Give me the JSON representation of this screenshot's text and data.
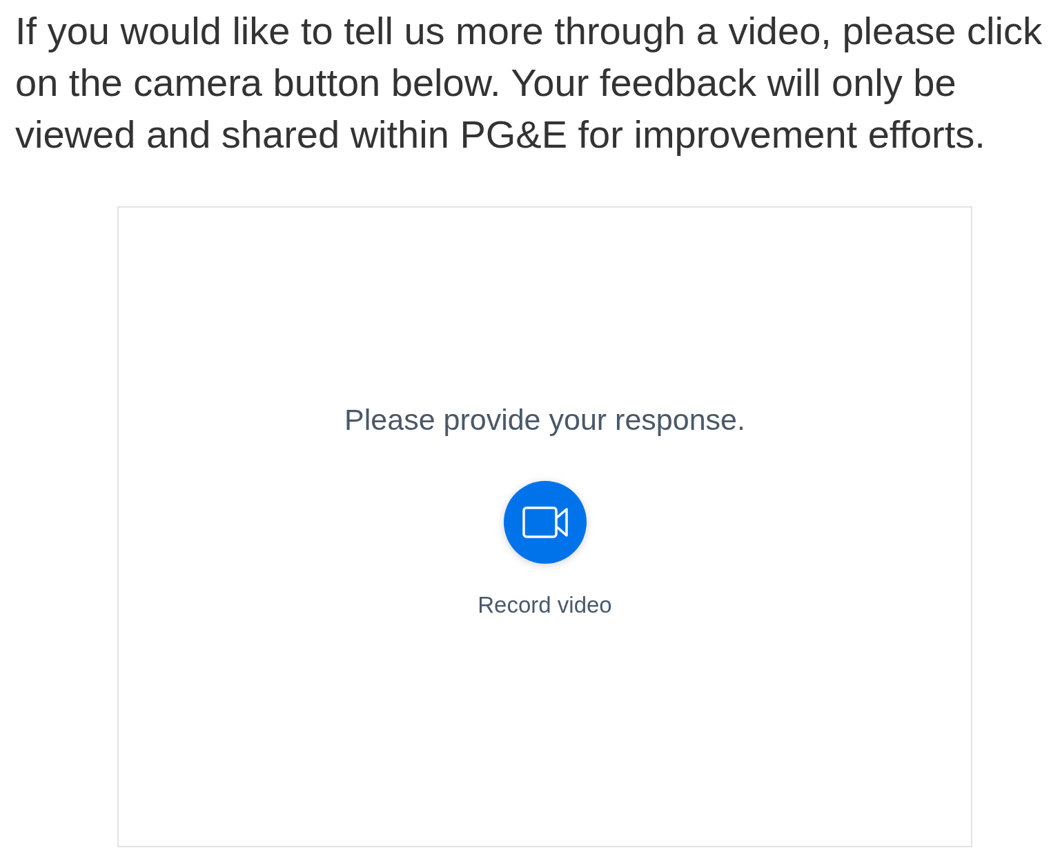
{
  "intro": {
    "text": "If you would like to tell us more through a video, please click on the camera button below. Your feedback will only be viewed and shared within PG&E for improvement efforts."
  },
  "response_panel": {
    "prompt": "Please provide your response.",
    "record_button": {
      "label": "Record video"
    }
  }
}
